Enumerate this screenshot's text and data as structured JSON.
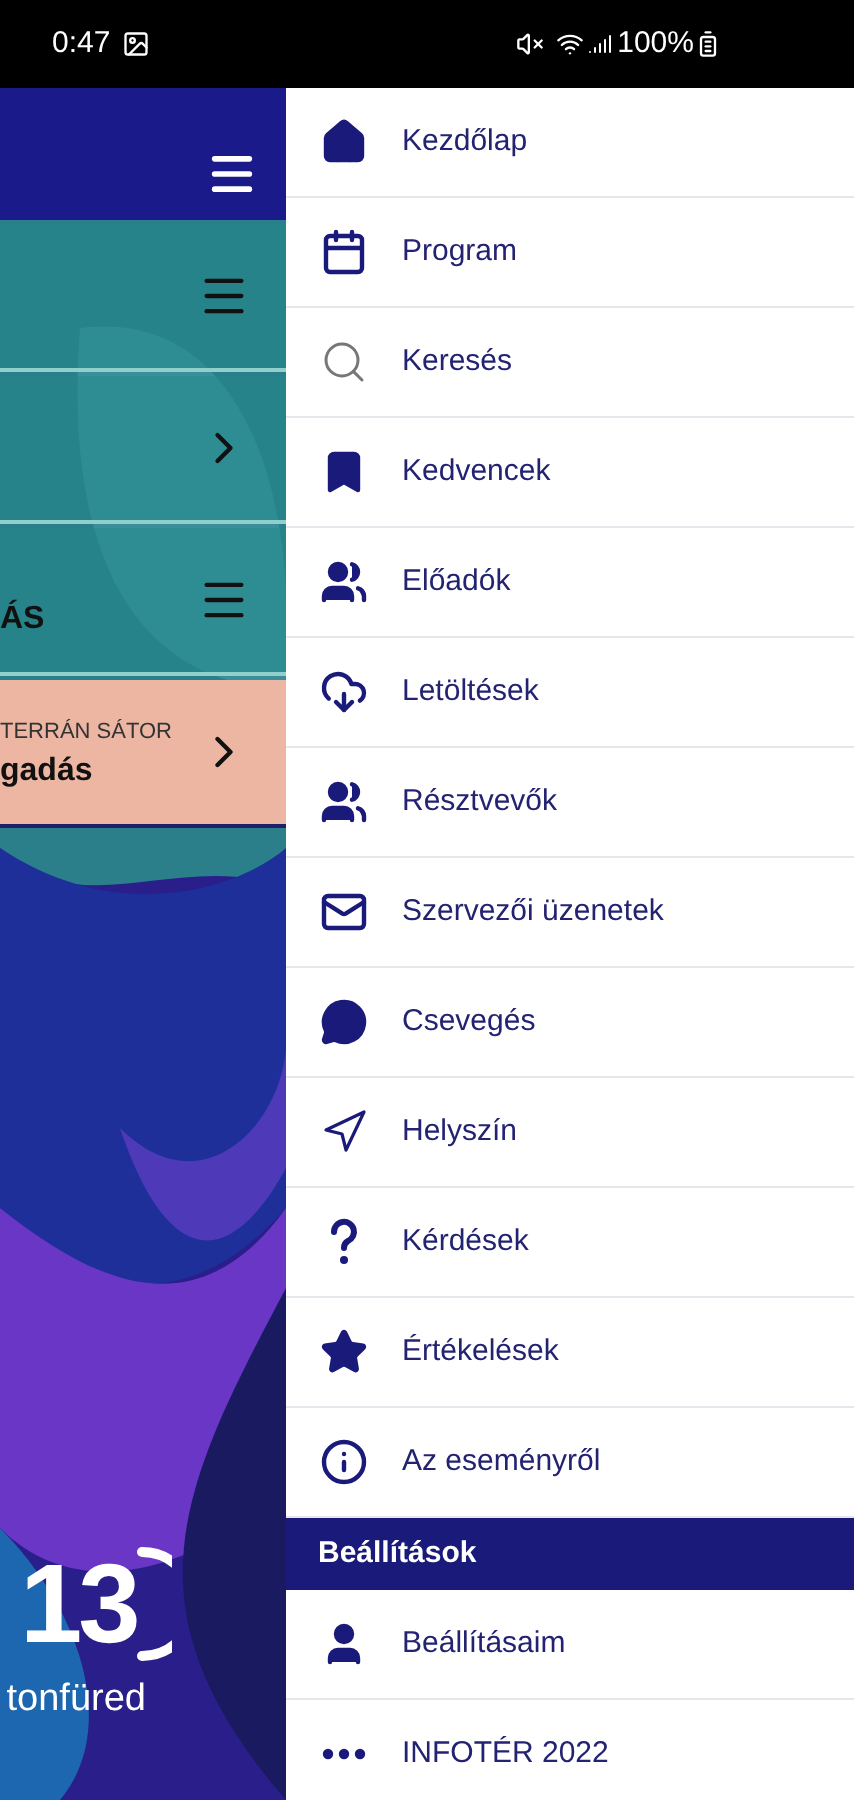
{
  "status_bar": {
    "time": "0:47",
    "battery": "100%"
  },
  "background": {
    "cards": [
      {
        "kind": "menu"
      },
      {
        "kind": "link"
      },
      {
        "kind": "menu",
        "title": "ÁS"
      },
      {
        "kind": "highlight",
        "title": "gadás",
        "subtitle": "TERRÁN SÁTOR"
      }
    ],
    "logo": {
      "mark": "13",
      "place": "tonfüred"
    }
  },
  "drawer": {
    "items": [
      {
        "kind": "home",
        "label": "Kezdőlap"
      },
      {
        "kind": "calendar",
        "label": "Program"
      },
      {
        "kind": "search",
        "label": "Keresés"
      },
      {
        "kind": "bookmark",
        "label": "Kedvencek"
      },
      {
        "kind": "speakers",
        "label": "Előadók"
      },
      {
        "kind": "download",
        "label": "Letöltések"
      },
      {
        "kind": "people",
        "label": "Résztvevők"
      },
      {
        "kind": "mail",
        "label": "Szervezői üzenetek"
      },
      {
        "kind": "chat",
        "label": "Csevegés"
      },
      {
        "kind": "location",
        "label": "Helyszín"
      },
      {
        "kind": "question",
        "label": "Kérdések"
      },
      {
        "kind": "star",
        "label": "Értékelések"
      },
      {
        "kind": "info",
        "label": "Az eseményről"
      }
    ],
    "section": {
      "title": "Beállítások",
      "items": [
        {
          "kind": "user",
          "label": "Beállításaim"
        },
        {
          "kind": "more",
          "label": "INFOTÉR 2022"
        }
      ]
    }
  }
}
